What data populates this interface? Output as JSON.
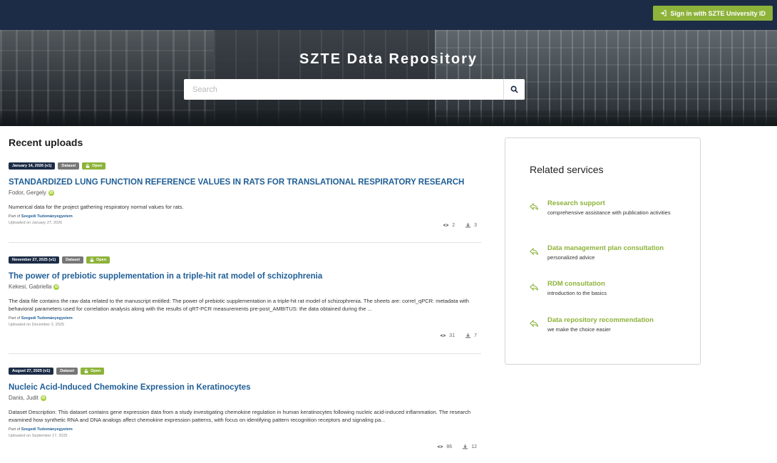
{
  "header": {
    "signin_label": "Sign in with SZTE University ID"
  },
  "hero": {
    "title": "SZTE Data Repository",
    "search_placeholder": "Search"
  },
  "recent": {
    "heading": "Recent uploads",
    "items": [
      {
        "date_label": "January 14, 2026 (v1)",
        "type_label": "Dataset",
        "access_label": "Open",
        "title": "STANDARDIZED LUNG FUNCTION REFERENCE VALUES IN RATS FOR TRANSLATIONAL RESPIRATORY RESEARCH",
        "creator": "Fodor, Gergely",
        "description": "Numerical data for the project gathering respiratory normal values for rats.",
        "part_of_prefix": "Part of",
        "community": "Szegedi Tudományegyetem",
        "uploaded": "Uploaded on January 27, 2026",
        "views": "2",
        "downloads": "3"
      },
      {
        "date_label": "November 27, 2025 (v1)",
        "type_label": "Dataset",
        "access_label": "Open",
        "title": "The power of prebiotic supplementation in a triple-hit rat model of schizophrenia",
        "creator": "Kekesi, Gabriella",
        "description": "The data file contains the raw data related to the manuscript entitled: The power of prebiotic supplementation in a triple-hit rat model of schizophrenia. The sheets are: correl_qPCR: metadata with behavioral parameters used for correlation analysis along with the results of qRT-PCR measurements pre-post_AMBITUS: the data obtained during the ...",
        "part_of_prefix": "Part of",
        "community": "Szegedi Tudományegyetem",
        "uploaded": "Uploaded on December 2, 2025",
        "views": "31",
        "downloads": "7"
      },
      {
        "date_label": "August 27, 2025 (v1)",
        "type_label": "Dataset",
        "access_label": "Open",
        "title": "Nucleic Acid-Induced Chemokine Expression in Keratinocytes",
        "creator": "Danis, Judit",
        "description": "Dataset Description: This dataset contains gene expression data from a study investigating chemokine regulation in human keratinocytes following nucleic acid-induced inflammation. The research examined how synthetic RNA and DNA analogs affect chemokine expression patterns, with focus on identifying pattern recognition receptors and signaling pa...",
        "part_of_prefix": "Part of",
        "community": "Szegedi Tudományegyetem",
        "uploaded": "Uploaded on September 17, 2025",
        "views": "86",
        "downloads": "12"
      }
    ]
  },
  "services": {
    "heading": "Related services",
    "items": [
      {
        "title": "Research support",
        "desc": "comprehensive assistance with publication activities",
        "icon": "share-arrow-icon"
      },
      {
        "title": "Data management plan consultation",
        "desc": "personalized advice",
        "icon": "share-arrow-icon"
      },
      {
        "title": "RDM consultation",
        "desc": "introduction to the basics",
        "icon": "share-arrow-icon"
      },
      {
        "title": "Data repository recommendation",
        "desc": "we make the choice easier",
        "icon": "share-arrow-icon"
      }
    ]
  },
  "colors": {
    "navy": "#1c2c46",
    "green": "#8db33a",
    "link_blue": "#1f5e96",
    "gray_label": "#767676"
  }
}
